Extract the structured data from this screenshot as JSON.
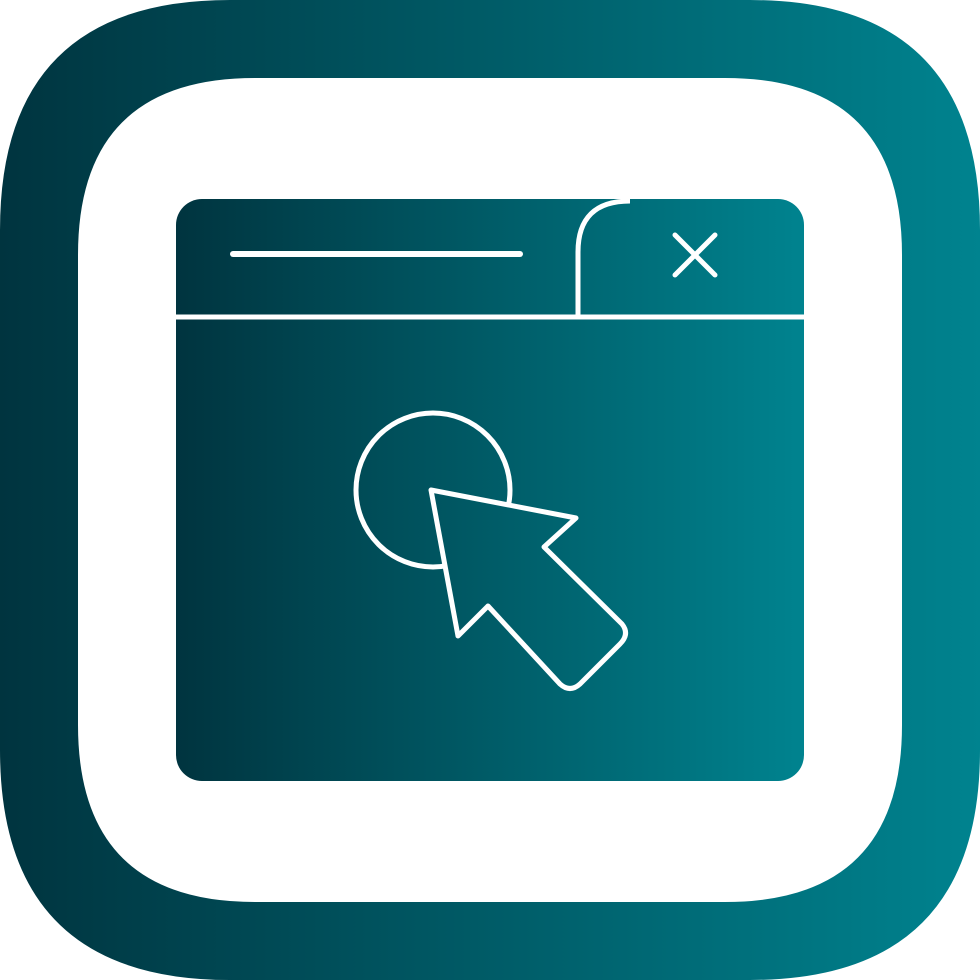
{
  "icon": {
    "name": "browser-click-icon",
    "parts": [
      "rounded-square-frame",
      "browser-window",
      "title-bar-line",
      "close-tab",
      "close-icon",
      "click-circle",
      "cursor-arrow-icon"
    ]
  },
  "colors": {
    "gradient_start": "#00343f",
    "gradient_end": "#00838f",
    "foreground": "#ffffff"
  }
}
